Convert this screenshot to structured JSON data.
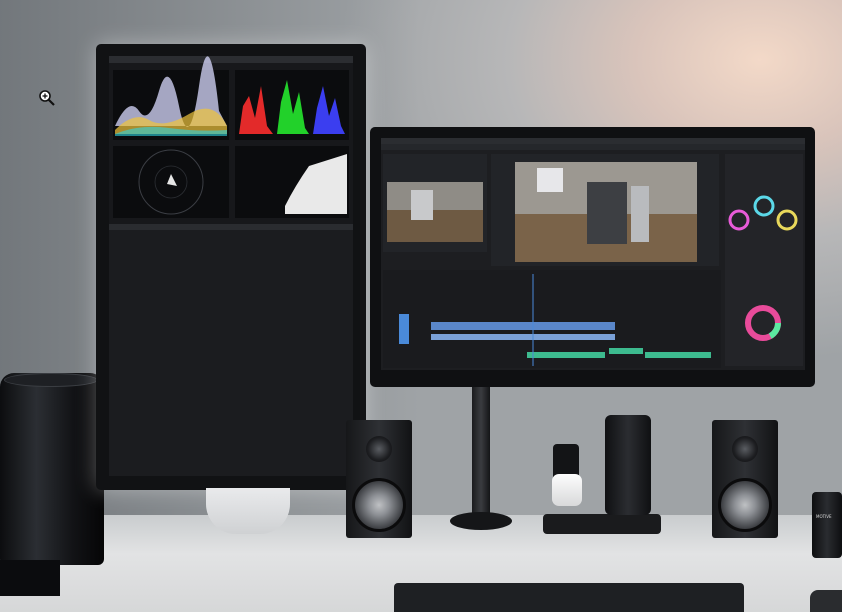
{
  "photo": {
    "devices": {
      "vertical_monitor_mode": "color-scopes-and-spreadsheet",
      "horizontal_monitor_mode": "video-editor-timeline",
      "jar_label": "MOTIVE"
    },
    "colors": {
      "wall_warm": "#f3d9c8",
      "wall_cool": "#9fa3a6",
      "desk": "#dcdddf",
      "device_black": "#141517",
      "ui_dark": "#1d1e21",
      "accent_blue": "#4a8ad9",
      "accent_green": "#3dbb8f"
    },
    "icons": [
      "zoom-in-icon",
      "color-wheel-icon"
    ]
  }
}
